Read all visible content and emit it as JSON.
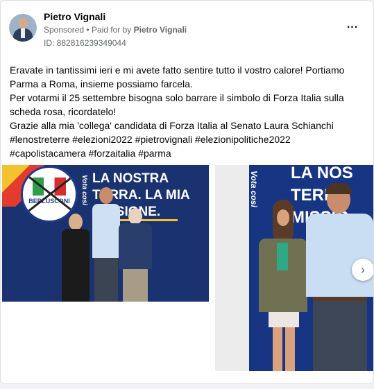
{
  "post": {
    "author": "Pietro Vignali",
    "sponsored": "Sponsored",
    "paid_prefix": "Paid for by",
    "paid_by": "Pietro Vignali",
    "ad_id": "ID: 882816239349044",
    "body_lines": [
      "Eravate in tantissimi ieri e mi avete fatto sentire tutto il vostro calore! Portiamo",
      "Parma a Roma, insieme possiamo farcela.",
      "Per votarmi il 25 settembre bisogna solo barrare il simbolo di Forza Italia sulla",
      "scheda rosa, ricordatelo!",
      "Grazie alla mia 'collega' candidata di Forza Italia al Senato Laura Schianchi",
      "#lenostreterre #elezioni2022 #pietrovignali #elezionipolitiche2022",
      "#capolistacamera #forzaitalia #parma"
    ]
  },
  "carousel": {
    "slide1_banner_lines": [
      "LA NOSTRA",
      "TERRA. LA MIA",
      "MISSIONE."
    ],
    "slide1_vota": "Vota così",
    "logo_text": "BERLUSCONI",
    "slide2_banner_lines": [
      "LA NOS",
      "TERRA",
      "MISSIO"
    ],
    "slide2_vota": "Vota così",
    "next_icon": "chevron-right-icon"
  }
}
